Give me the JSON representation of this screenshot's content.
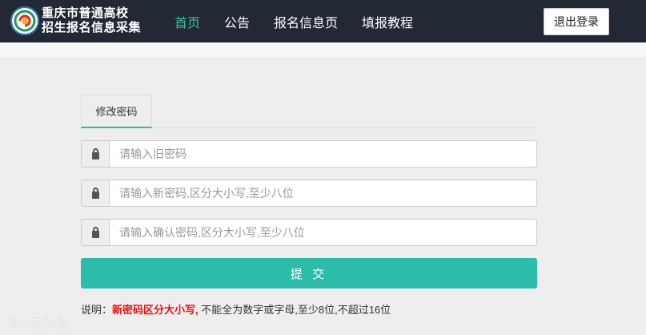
{
  "header": {
    "title_line1": "重庆市普通高校",
    "title_line2": "招生报名信息采集",
    "logo_icon": "emblem-icon",
    "logout_label": "退出登录"
  },
  "nav": {
    "items": [
      {
        "label": "首页",
        "active": true
      },
      {
        "label": "公告",
        "active": false
      },
      {
        "label": "报名信息页",
        "active": false
      },
      {
        "label": "填报教程",
        "active": false
      }
    ]
  },
  "tabs": {
    "active_label": "修改密码"
  },
  "form": {
    "old_password": {
      "placeholder": "请输入旧密码",
      "value": "",
      "icon": "lock-icon"
    },
    "new_password": {
      "placeholder": "请输入新密码,区分大小写,至少八位",
      "value": "",
      "icon": "lock-icon"
    },
    "confirm_password": {
      "placeholder": "请输入确认密码,区分大小写,至少八位",
      "value": "",
      "icon": "lock-icon"
    },
    "submit_label": "提 交"
  },
  "note": {
    "prefix": "说明：",
    "emphasis": "新密码区分大小写,",
    "rest": " 不能全为数字或字母,至少8位,不超过16位"
  },
  "watermark": {
    "text": "大数跨境"
  },
  "colors": {
    "topbar": "#222834",
    "accent": "#2bbcaa",
    "nav_active": "#3bc0a3",
    "note_emphasis": "#ee1111"
  }
}
